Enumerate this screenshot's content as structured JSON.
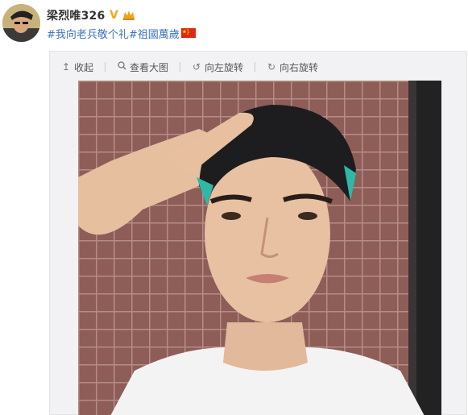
{
  "post": {
    "username": "梁烈唯326",
    "badges": {
      "verified_icon": "verified-v-icon",
      "vip_icon": "crown-vip-icon"
    },
    "text": {
      "hashtag1": "#我向老兵敬个礼",
      "hashtag2": "#祖國萬歲",
      "flag": "china-flag-icon"
    }
  },
  "toolbar": {
    "collapse": {
      "icon": "arrow-up-icon",
      "label": "收起"
    },
    "view_large": {
      "icon": "search-icon",
      "label": "查看大图"
    },
    "rotate_left": {
      "icon": "rotate-left-icon",
      "label": "向左旋转"
    },
    "rotate_right": {
      "icon": "rotate-right-icon",
      "label": "向右旋转"
    }
  },
  "colors": {
    "hashtag": "#3b73b9",
    "username": "#333333",
    "verified": "#f2a81d",
    "card_bg": "#f2f2f5"
  }
}
